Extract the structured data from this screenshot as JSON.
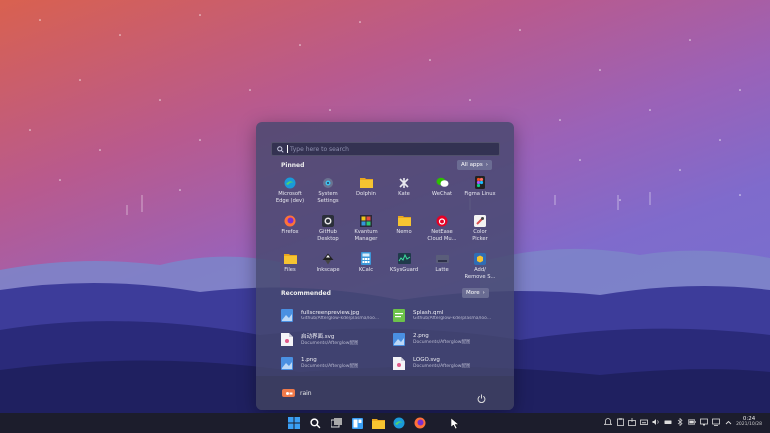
{
  "search": {
    "placeholder": "Type here to search"
  },
  "pinned": {
    "title": "Pinned",
    "all_apps_label": "All apps"
  },
  "apps": [
    {
      "label": "Microsoft\nEdge (dev)",
      "icon": "edge-icon"
    },
    {
      "label": "System\nSettings",
      "icon": "settings-icon"
    },
    {
      "label": "Dolphin",
      "icon": "folder-icon"
    },
    {
      "label": "Kate",
      "icon": "kate-icon"
    },
    {
      "label": "WeChat",
      "icon": "wechat-icon"
    },
    {
      "label": "Figma Linux",
      "icon": "figma-icon"
    },
    {
      "label": "Firefox",
      "icon": "firefox-icon"
    },
    {
      "label": "GitHub\nDesktop",
      "icon": "github-icon"
    },
    {
      "label": "Kvantum\nManager",
      "icon": "kvantum-icon"
    },
    {
      "label": "Nemo",
      "icon": "folder-icon"
    },
    {
      "label": "NetEase\nCloud Mu...",
      "icon": "netease-icon"
    },
    {
      "label": "Color\nPicker",
      "icon": "color-picker-icon"
    },
    {
      "label": "Files",
      "icon": "folder-icon"
    },
    {
      "label": "Inkscape",
      "icon": "inkscape-icon"
    },
    {
      "label": "KCalc",
      "icon": "calculator-icon"
    },
    {
      "label": "KSysGuard",
      "icon": "system-monitor-icon"
    },
    {
      "label": "Latte",
      "icon": "latte-icon"
    },
    {
      "label": "Add/\nRemove S...",
      "icon": "package-icon"
    }
  ],
  "recommended": {
    "title": "Recommended",
    "more_label": "More",
    "items": [
      {
        "name": "fullscreenpreview.jpg",
        "path": "Github/Afterglow-kde/plasma/loo...",
        "icon": "image-file-icon"
      },
      {
        "name": "Splash.qml",
        "path": "Github/Afterglow-kde/plasma/loo...",
        "icon": "qml-file-icon"
      },
      {
        "name": "启动界面.svg",
        "path": "Documents/Afterglow配图",
        "icon": "svg-file-icon"
      },
      {
        "name": "2.png",
        "path": "Documents/Afterglow配图",
        "icon": "image-file-icon"
      },
      {
        "name": "1.png",
        "path": "Documents/Afterglow配图",
        "icon": "image-file-icon"
      },
      {
        "name": "LOGO.svg",
        "path": "Documents/Afterglow配图",
        "icon": "svg-file-icon"
      }
    ]
  },
  "user": {
    "name": "rain"
  },
  "clock": {
    "time": "0:24",
    "date": "2021/10/28"
  },
  "colors": {
    "accent": "#f07a4a",
    "taskbar": "#1c1d2c",
    "menu": "#46486e"
  }
}
